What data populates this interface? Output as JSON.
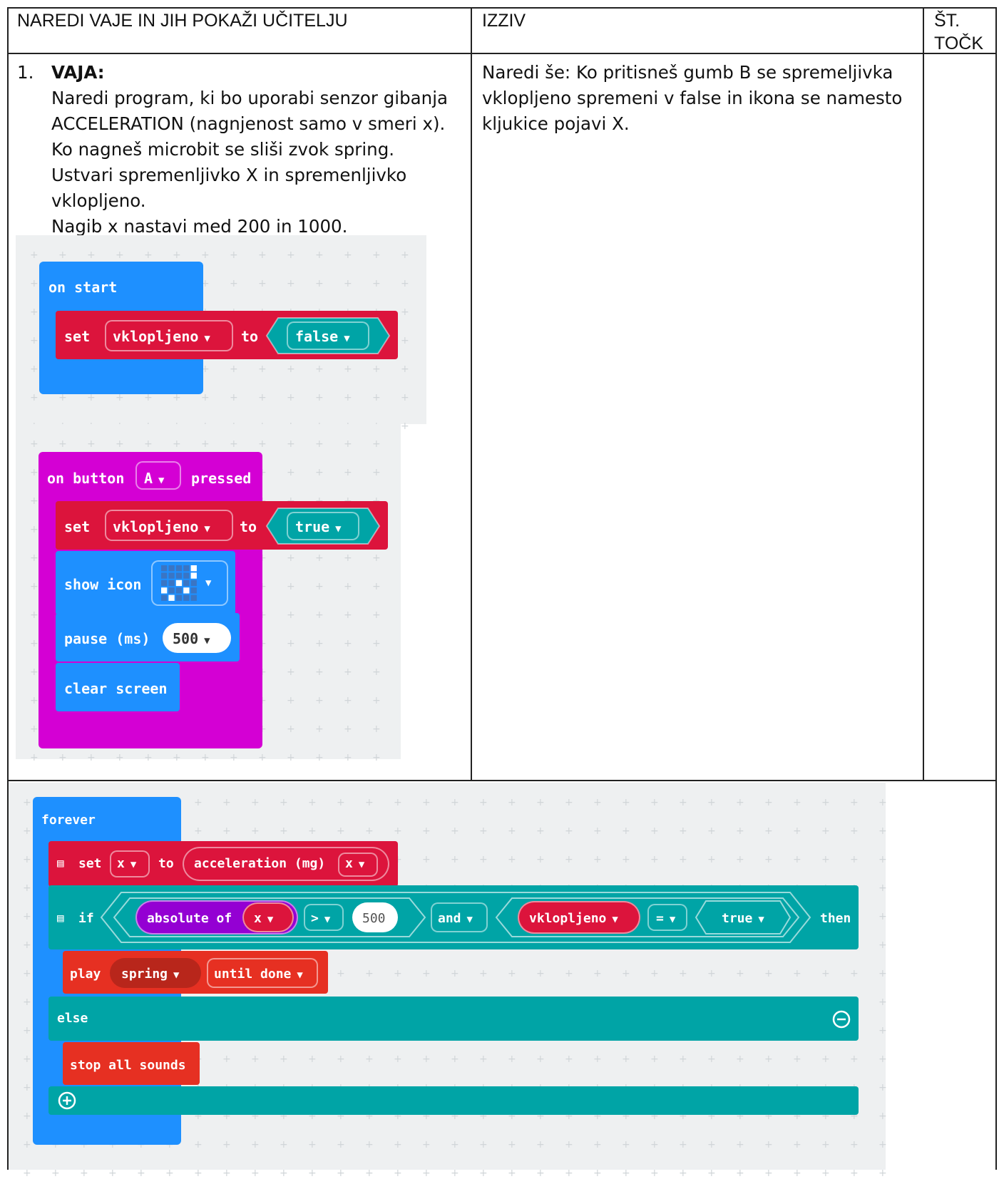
{
  "table": {
    "headers": [
      "NAREDI VAJE IN JIH POKAŽI UČITELJU",
      "IZZIV",
      "ŠT.",
      "TOČK"
    ]
  },
  "task": {
    "number": "1.",
    "title": "VAJA:",
    "lines": [
      "Naredi program, ki bo uporabi senzor gibanja",
      "ACCELERATION (nagnjenost samo v smeri x).",
      "Ko nagneš microbit se sliši zvok spring.",
      "Ustvari spremenljivko X in spremenljivko",
      "vklopljeno.",
      "Nagib x nastavi med 200 in 1000."
    ]
  },
  "challenge": {
    "lines": [
      "Naredi še: Ko pritisneš gumb B se spremeljivka",
      "vklopljeno spremeni v false in ikona se namesto",
      "kljukice pojavi X."
    ]
  },
  "blocks": {
    "on_start": "on start",
    "set1": "set",
    "var1": "vklopljeno",
    "to1": "to",
    "false_val": "false",
    "on_button": "on button",
    "button_A": "A",
    "pressed": "pressed",
    "set2": "set",
    "var2": "vklopljeno",
    "to2": "to",
    "true_val": "true",
    "show_icon": "show icon",
    "pause": "pause (ms)",
    "pause_val": "500",
    "clear_screen": "clear screen",
    "forever": "forever",
    "set3": "set",
    "var_x": "x",
    "to3": "to",
    "accel": "acceleration (mg)",
    "accel_axis": "x",
    "if": "if",
    "absolute_of": "absolute of",
    "abs_var": "x",
    "gt": ">",
    "compare_val": "500",
    "and": "and",
    "var3": "vklopljeno",
    "eq": "=",
    "true_val2": "true",
    "then": "then",
    "play": "play",
    "sound": "spring",
    "until_done": "until done",
    "else": "else",
    "stop_all": "stop all sounds"
  },
  "colors": {
    "events_blue": "#1e90ff",
    "variables_red": "#dc143c",
    "logic_teal": "#00a4a6",
    "input_magenta": "#d400d4",
    "math_purple": "#9400d3",
    "music_red": "#e63022"
  },
  "icons": [
    "dropdown-triangle-icon",
    "comment-icon",
    "minus-circle-icon",
    "plus-circle-icon",
    "led-checkmark-icon"
  ]
}
